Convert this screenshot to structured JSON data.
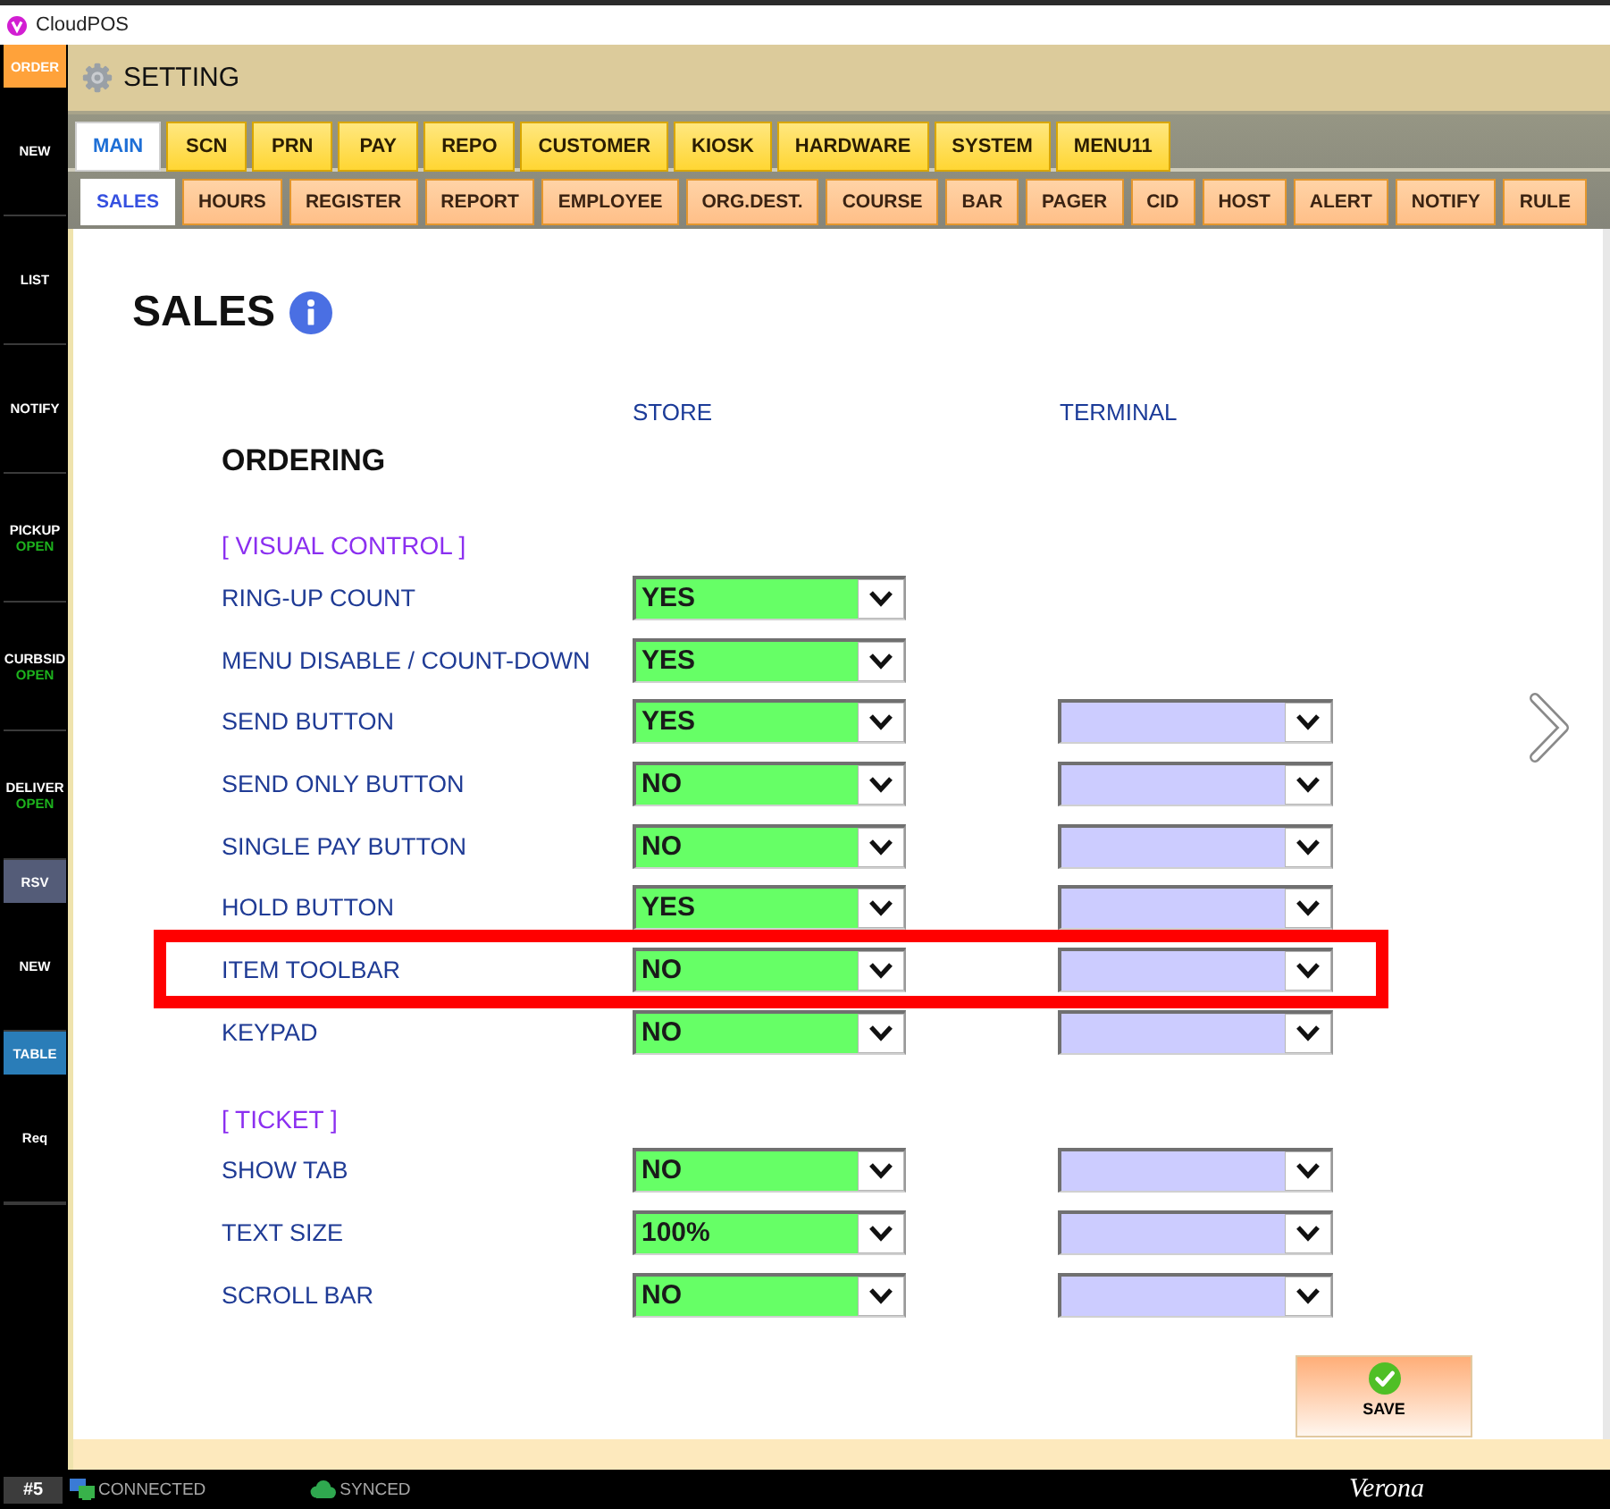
{
  "window": {
    "title": "CloudPOS"
  },
  "sidebar": {
    "items": [
      {
        "kind": "header",
        "label": "ORDER",
        "color": "#ffa23a"
      },
      {
        "kind": "item",
        "label": "NEW"
      },
      {
        "kind": "item",
        "label": "LIST"
      },
      {
        "kind": "item",
        "label": "NOTIFY"
      },
      {
        "kind": "item",
        "label": "PICKUP",
        "status": "OPEN"
      },
      {
        "kind": "item",
        "label": "CURBSID",
        "status": "OPEN"
      },
      {
        "kind": "item",
        "label": "DELIVER",
        "status": "OPEN"
      },
      {
        "kind": "header",
        "label": "RSV",
        "color": "#545c78"
      },
      {
        "kind": "item",
        "label": "NEW"
      },
      {
        "kind": "header",
        "label": "TABLE",
        "color": "#2a7db8"
      },
      {
        "kind": "item",
        "label": "Req"
      }
    ]
  },
  "header": {
    "title": "SETTING"
  },
  "main_tabs": [
    {
      "label": "MAIN",
      "selected": true
    },
    {
      "label": "SCN",
      "selected": false
    },
    {
      "label": "PRN",
      "selected": false
    },
    {
      "label": "PAY",
      "selected": false
    },
    {
      "label": "REPO",
      "selected": false
    },
    {
      "label": "CUSTOMER",
      "selected": false
    },
    {
      "label": "KIOSK",
      "selected": false
    },
    {
      "label": "HARDWARE",
      "selected": false
    },
    {
      "label": "SYSTEM",
      "selected": false
    },
    {
      "label": "MENU11",
      "selected": false
    }
  ],
  "sub_tabs": [
    {
      "label": "SALES",
      "selected": true
    },
    {
      "label": "HOURS",
      "selected": false
    },
    {
      "label": "REGISTER",
      "selected": false
    },
    {
      "label": "REPORT",
      "selected": false
    },
    {
      "label": "EMPLOYEE",
      "selected": false
    },
    {
      "label": "ORG.DEST.",
      "selected": false
    },
    {
      "label": "COURSE",
      "selected": false
    },
    {
      "label": "BAR",
      "selected": false
    },
    {
      "label": "PAGER",
      "selected": false
    },
    {
      "label": "CID",
      "selected": false
    },
    {
      "label": "HOST",
      "selected": false
    },
    {
      "label": "ALERT",
      "selected": false
    },
    {
      "label": "NOTIFY",
      "selected": false
    },
    {
      "label": "RULE",
      "selected": false
    }
  ],
  "page": {
    "title": "SALES",
    "columns": [
      "STORE",
      "TERMINAL"
    ],
    "section": "ORDERING",
    "groups": [
      {
        "title": "[ VISUAL CONTROL ]",
        "rows": [
          {
            "label": "RING-UP COUNT",
            "kind": "store",
            "store": "YES",
            "highlighted": false
          },
          {
            "label": "MENU DISABLE / COUNT-DOWN",
            "kind": "store",
            "store": "YES",
            "highlighted": false
          },
          {
            "label": "SEND BUTTON",
            "kind": "both",
            "store": "YES",
            "highlighted": false
          },
          {
            "label": "SEND ONLY BUTTON",
            "kind": "both",
            "store": "NO",
            "highlighted": false
          },
          {
            "label": "SINGLE PAY BUTTON",
            "kind": "both",
            "store": "NO",
            "highlighted": false
          },
          {
            "label": "HOLD BUTTON",
            "kind": "both",
            "store": "YES",
            "highlighted": false
          },
          {
            "label": "ITEM TOOLBAR",
            "kind": "both",
            "store": "NO",
            "highlighted": true
          },
          {
            "label": "KEYPAD",
            "kind": "both",
            "store": "NO",
            "highlighted": false
          }
        ]
      },
      {
        "title": "[ TICKET ]",
        "rows": [
          {
            "label": "SHOW TAB",
            "kind": "both",
            "store": "NO",
            "highlighted": false
          },
          {
            "label": "TEXT SIZE",
            "kind": "both",
            "store": "100%",
            "highlighted": false
          },
          {
            "label": "SCROLL BAR",
            "kind": "both",
            "store": "NO",
            "highlighted": false
          }
        ]
      }
    ]
  },
  "save_button": {
    "label": "SAVE"
  },
  "status_bar": {
    "terminal": "#5",
    "connection": "CONNECTED",
    "sync": "SYNCED",
    "location": "Verona"
  }
}
